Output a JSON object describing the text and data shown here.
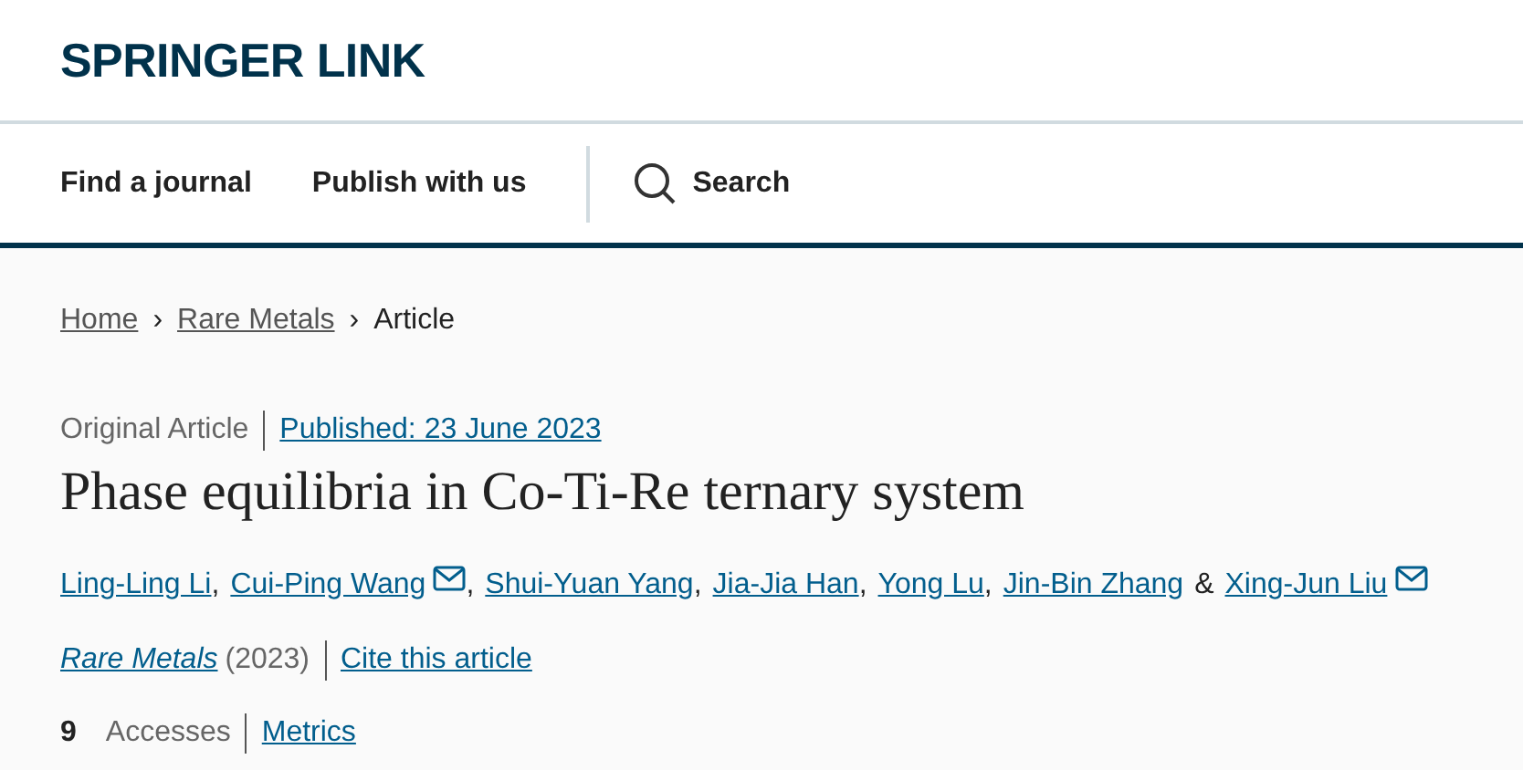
{
  "logo": "SPRINGER LINK",
  "nav": [
    {
      "label": "Find a journal",
      "kind": "link"
    },
    {
      "label": "Publish with us",
      "kind": "link"
    },
    {
      "label": "Search",
      "kind": "search"
    }
  ],
  "breadcrumb": [
    {
      "label": "Home",
      "current": false
    },
    {
      "label": "Rare Metals",
      "current": false
    },
    {
      "label": "Article",
      "current": true
    }
  ],
  "separator_icon": "›",
  "article_type": "Original Article",
  "published": "Published: 23 June 2023",
  "title": "Phase equilibria in Co-Ti-Re ternary system",
  "authors": [
    {
      "name": "Ling-Ling Li",
      "email": false,
      "after": ","
    },
    {
      "name": "Cui-Ping Wang",
      "email": true,
      "after": ","
    },
    {
      "name": "Shui-Yuan Yang",
      "email": false,
      "after": ","
    },
    {
      "name": "Jia-Jia Han",
      "email": false,
      "after": ","
    },
    {
      "name": "Yong Lu",
      "email": false,
      "after": ","
    },
    {
      "name": "Jin-Bin Zhang",
      "email": false,
      "after": "&"
    },
    {
      "name": "Xing-Jun Liu",
      "email": true
    }
  ],
  "journal": "Rare Metals",
  "year": "(2023)",
  "cite": "Cite this article",
  "accesses_count": "9",
  "accesses_label": "Accesses",
  "metrics": "Metrics"
}
